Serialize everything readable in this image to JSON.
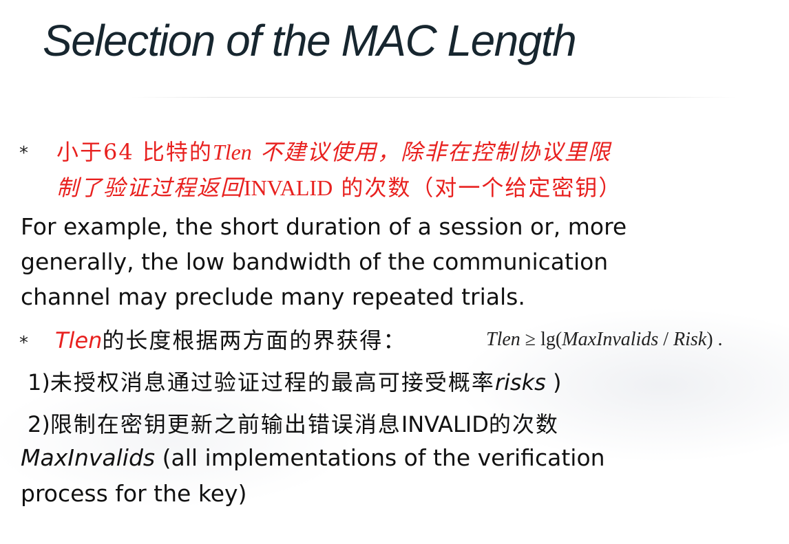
{
  "title": "Selection of the MAC Length",
  "bullet1": {
    "marker": "*",
    "line1_a": "小于64 比特的",
    "line1_tlen": "Tlen",
    "line1_b": " 不建议使用，除非在控制协议里限",
    "line2_a": "制了验证过程返回",
    "line2_invalid": "INVALID",
    "line2_b": " 的次数（对一个给定密钥）"
  },
  "paragraph1": {
    "line1": "For example, the short duration of a session or, more",
    "line2": "generally, the low bandwidth of the communication",
    "line3": "channel may preclude many repeated trials."
  },
  "bullet2": {
    "marker": "*",
    "tlen": "Tlen",
    "text": "的长度根据两方面的界获得：",
    "formula_lhs": "Tlen",
    "formula_op": " ≥ lg(",
    "formula_arg": "MaxInvalids",
    "formula_sep": " / ",
    "formula_risk": "Risk",
    "formula_end": ") ."
  },
  "item1": {
    "num": "1)",
    "text": "未授权消息通过验证过程的最高可接受概率",
    "risks": "risks",
    "end": " )"
  },
  "item2": {
    "num": "2)",
    "text_a": "限制在密钥更新之前输出错误消息",
    "invalid": "INVALID",
    "text_b": "的次数"
  },
  "paragraph2": {
    "maxinvalids": "MaxInvalids",
    "line1_rest": " (all implementations of the verification",
    "line2": "process for the key)"
  }
}
